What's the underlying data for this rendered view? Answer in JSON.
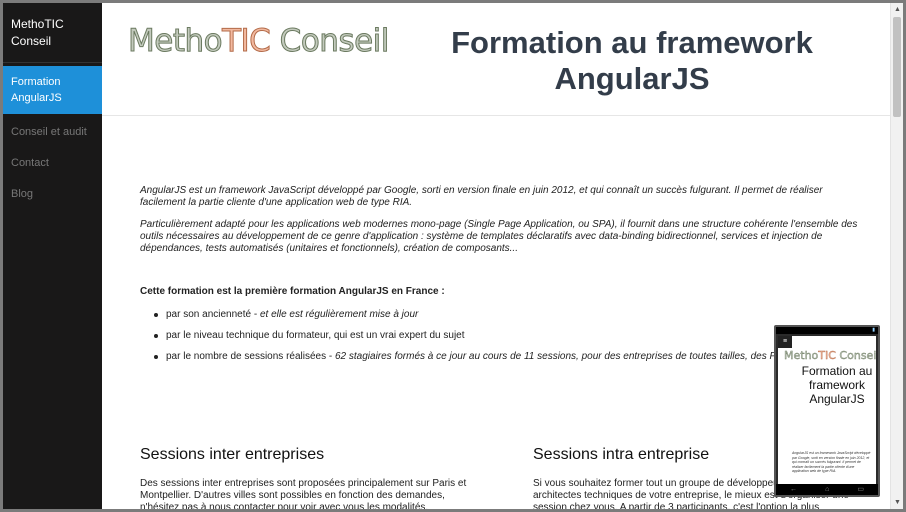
{
  "sidebar": {
    "brand": "MethoTIC Conseil",
    "items": [
      {
        "label": "Formation AngularJS",
        "active": true
      },
      {
        "label": "Conseil et audit",
        "active": false
      },
      {
        "label": "Contact",
        "active": false
      },
      {
        "label": "Blog",
        "active": false
      }
    ]
  },
  "header": {
    "logo_part1": "Metho",
    "logo_part2": "TIC",
    "logo_part3": " Conseil",
    "title": "Formation au framework AngularJS"
  },
  "intro": {
    "p1": "AngularJS est un framework JavaScript développé par Google, sorti en version finale en juin 2012, et qui connaît un succès fulgurant. Il permet de réaliser facilement la partie cliente d'une application web de type RIA.",
    "p2": "Particulièrement adapté pour les applications web modernes mono-page (Single Page Application, ou SPA), il fournit dans une structure cohérente l'ensemble des outils nécessaires au développement de ce genre d'application : système de templates déclaratifs avec data-binding bidirectionnel, services et injection de dépendances, tests automatisés (unitaires et fonctionnels), création de composants..."
  },
  "first_training": {
    "heading": "Cette formation est la première formation AngularJS en France :",
    "reasons": [
      {
        "lead": "par son ancienneté - ",
        "detail": "et elle est régulièrement mise à jour"
      },
      {
        "lead": "par le niveau technique du formateur, qui est un vrai expert du sujet",
        "detail": ""
      },
      {
        "lead": "par le nombre de sessions réalisées - ",
        "detail": "62 stagiaires formés à ce jour au cours de 11 sessions, pour des entreprises de toutes tailles, des PME"
      }
    ]
  },
  "sessions": {
    "inter": {
      "title": "Sessions inter entreprises",
      "text": "Des sessions inter entreprises sont proposées principalement sur Paris et Montpellier. D'autres villes sont possibles en fonction des demandes, n'hésitez pas à nous contacter pour voir avec vous les modalités."
    },
    "intra": {
      "title": "Sessions intra entreprise",
      "text": "Si vous souhaitez former tout un groupe de développeurs ou les architectes techniques de votre entreprise, le mieux est d'organiser une session chez vous. A partir de 3 participants, c'est l'option la plus avantageuse."
    }
  },
  "phone_preview": {
    "logo_part1": "Metho",
    "logo_part2": "TIC",
    "logo_part3": " Conseil",
    "title": "Formation au framework AngularJS",
    "text": "AngularJS est un framework JavaScript développé par Google, sorti en version finale en juin 2012, et qui connaît un succès fulgurant. Il permet de réaliser facilement la partie cliente d'une application web de type RIA."
  }
}
